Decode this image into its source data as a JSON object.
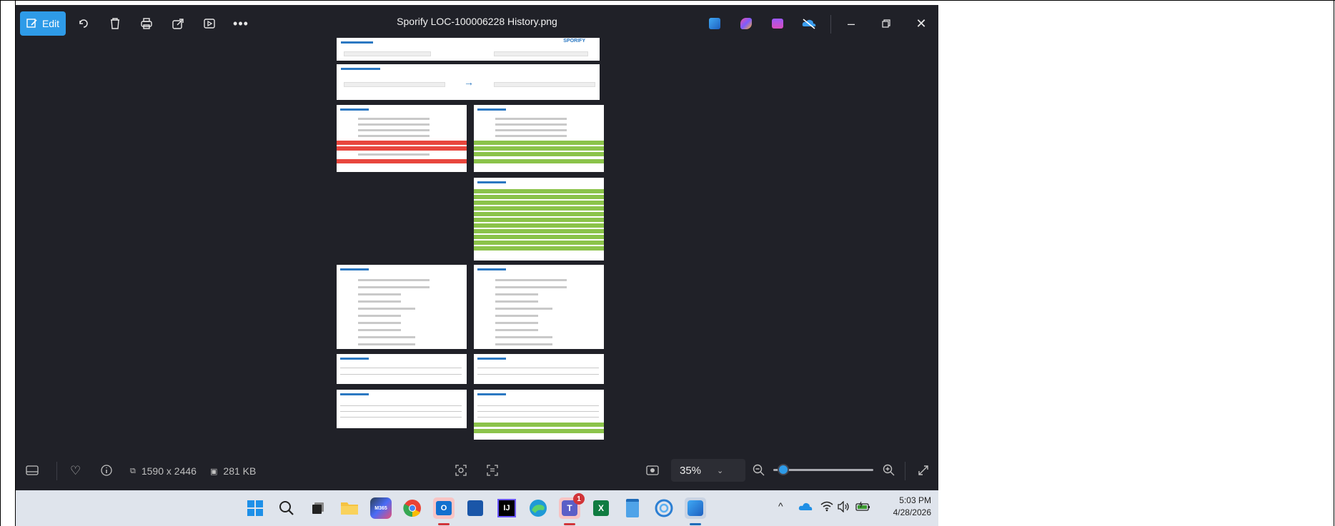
{
  "window": {
    "title": "Sporify LOC-100006228 History.png",
    "edit_label": "Edit",
    "toolbar_icons": [
      "rotate-icon",
      "delete-icon",
      "print-icon",
      "share-icon",
      "slideshow-icon",
      "more-icon"
    ],
    "right_icons": [
      "paint-icon",
      "copilot-icon",
      "clipchamp-icon",
      "onedrive-off-icon"
    ],
    "window_controls": [
      "minimize",
      "restore",
      "close"
    ]
  },
  "document": {
    "logo": "SPORIFY",
    "rows_left_red": 3,
    "rows_right_green": 4
  },
  "statusbar": {
    "dimensions": "1590 x 2446",
    "file_size": "281 KB",
    "zoom": "35%",
    "zoom_level": 0.05
  },
  "taskbar": {
    "time": "5:03 PM",
    "date": "4/28/2026",
    "teams_badge": "1"
  },
  "colors": {
    "accent": "#2e9be8",
    "red": "#e8463d",
    "green": "#8bc34a"
  }
}
